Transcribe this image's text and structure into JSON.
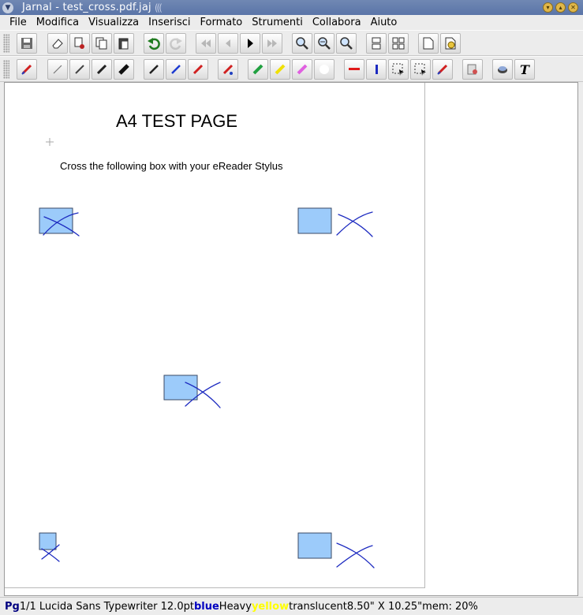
{
  "window": {
    "title": "Jarnal - test_cross.pdf.jaj",
    "menu_icon": "window-menu-icon",
    "buttons": [
      "minimize-icon",
      "maximize-icon",
      "close-icon"
    ]
  },
  "menu": {
    "items": [
      "File",
      "Modifica",
      "Visualizza",
      "Inserisci",
      "Formato",
      "Strumenti",
      "Collabora",
      "Aiuto"
    ]
  },
  "toolbar1": {
    "icons": [
      "save-icon",
      "eraser-icon",
      "cut-icon",
      "copy-icon",
      "paste-icon",
      "undo-icon",
      "redo-icon",
      "first-page-icon",
      "previous-page-icon",
      "next-page-icon",
      "last-page-icon",
      "zoom-in-icon",
      "zoom-out-icon",
      "zoom-fit-icon",
      "single-page-layout-icon",
      "grid-layout-icon",
      "new-page-icon",
      "open-page-icon"
    ]
  },
  "toolbar2": {
    "icons": [
      "pen-red-icon",
      "pen-fine-icon",
      "pen-medium-icon",
      "pen-heavy-icon",
      "pen-fat-icon",
      "pen-black-icon",
      "pen-blue-icon",
      "pen-red-icon-2",
      "pen-multicolor-icon",
      "highlighter-green-icon",
      "highlighter-yellow-icon",
      "highlighter-pink-icon",
      "white-color-icon",
      "red-line-icon",
      "blue-line-icon",
      "rectangle-select-icon",
      "lasso-select-icon",
      "pen-select-icon",
      "page-setup-icon",
      "stroke-eraser-icon",
      "text-tool-icon"
    ]
  },
  "page": {
    "title": "A4 TEST PAGE",
    "subtitle": "Cross the following box with your eReader Stylus"
  },
  "colors": {
    "box_fill": "#9ccbfa",
    "box_stroke": "#3a4a66",
    "stroke_ink": "#1c2ac0"
  },
  "status": {
    "page_label": "Pg",
    "page_info": "1/1 Lucida Sans Typewriter 12.0pt",
    "color_name": "blue",
    "weight": "Heavy",
    "highlighter": "yellow",
    "mode": "translucent",
    "size": "8.50\" X 10.25\"",
    "mem": "mem: 20%"
  }
}
